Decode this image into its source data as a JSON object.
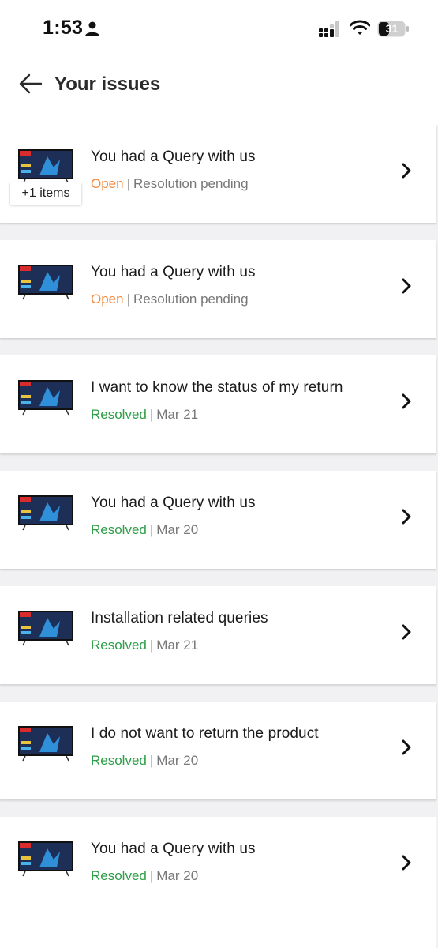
{
  "status_bar": {
    "time": "1:53",
    "battery": "31"
  },
  "header": {
    "title": "Your issues"
  },
  "issues": [
    {
      "title": "You had a Query with us",
      "status": "Open",
      "status_kind": "open",
      "detail": "Resolution pending",
      "badge": "+1 items"
    },
    {
      "title": "You had a Query with us",
      "status": "Open",
      "status_kind": "open",
      "detail": "Resolution pending"
    },
    {
      "title": "I want to know the status of my return",
      "status": "Resolved",
      "status_kind": "resolved",
      "detail": "Mar 21"
    },
    {
      "title": "You had a Query with us",
      "status": "Resolved",
      "status_kind": "resolved",
      "detail": "Mar 20"
    },
    {
      "title": "Installation related queries",
      "status": "Resolved",
      "status_kind": "resolved",
      "detail": "Mar 21"
    },
    {
      "title": "I do not want to return the product",
      "status": "Resolved",
      "status_kind": "resolved",
      "detail": "Mar 20"
    },
    {
      "title": "You had a Query with us",
      "status": "Resolved",
      "status_kind": "resolved",
      "detail": "Mar 20"
    }
  ],
  "colors": {
    "open": "#f28b40",
    "resolved": "#2e9e48",
    "background": "#f1f1f3"
  },
  "icons": [
    "person-icon",
    "signal-icon",
    "wifi-icon",
    "battery-icon",
    "back-arrow-icon",
    "tv-thumbnail",
    "chevron-right-icon"
  ]
}
